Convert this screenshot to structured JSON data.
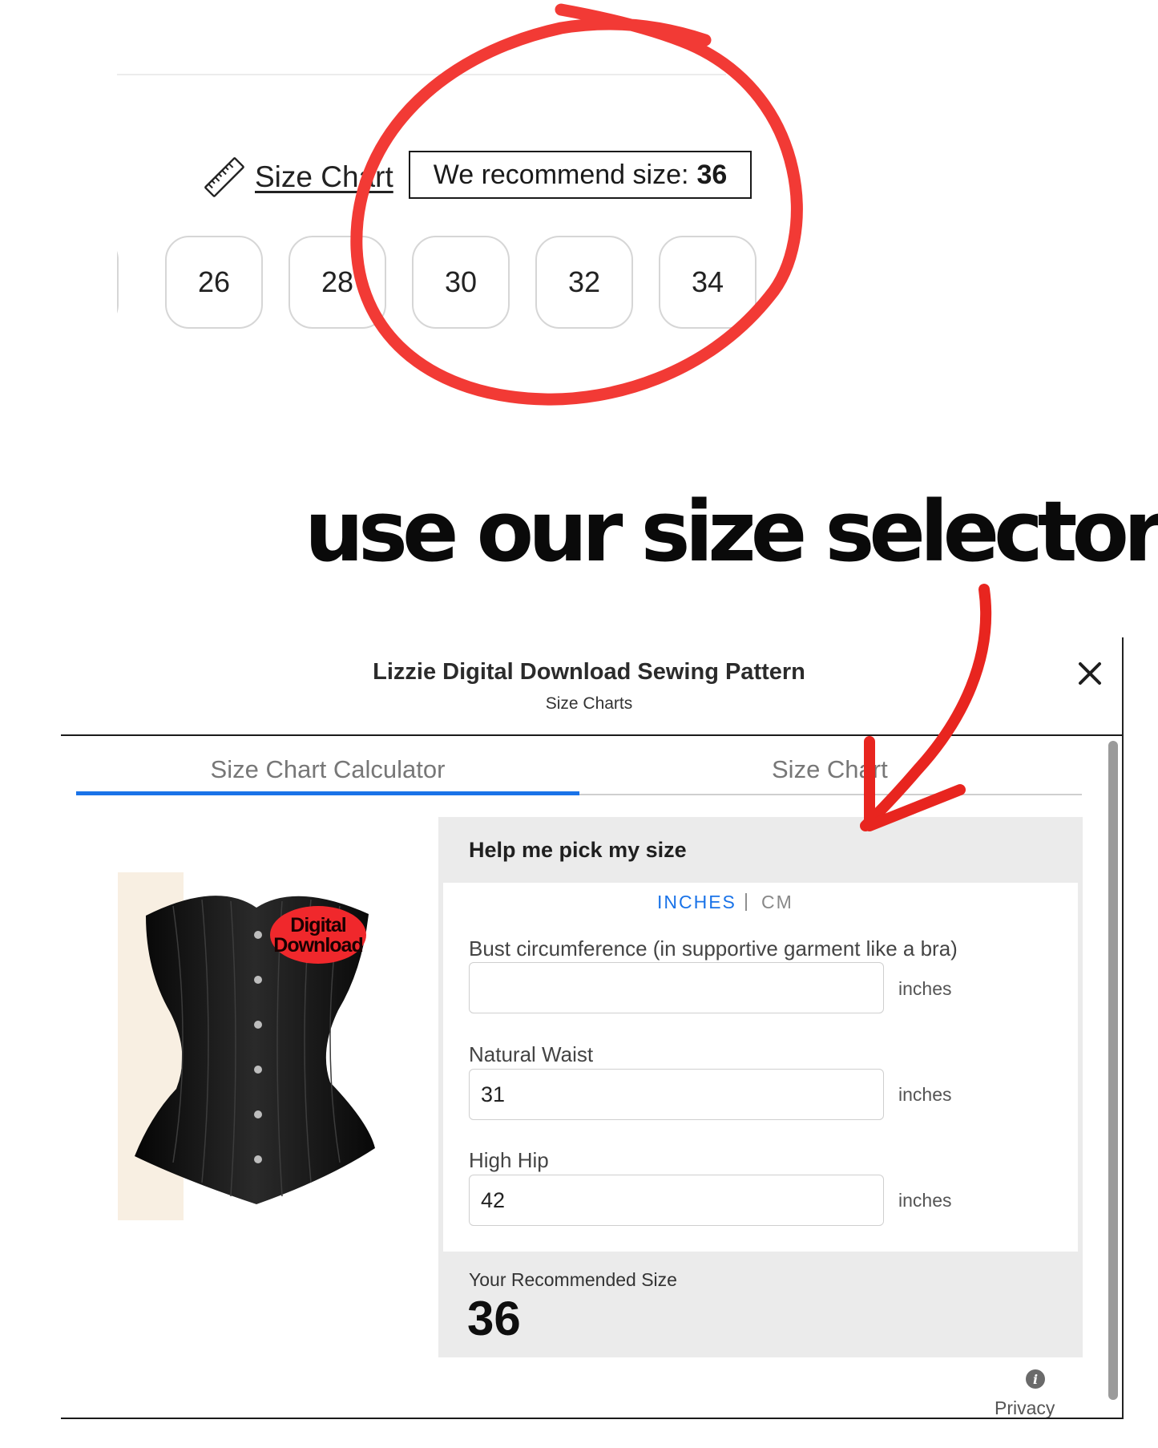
{
  "product_page": {
    "size_chart_label": "Size Chart",
    "recommend_prefix": "We recommend size:",
    "recommend_value": "36",
    "sizes": [
      "26",
      "28",
      "30",
      "32",
      "34"
    ]
  },
  "annotation": {
    "text": "use our size selector",
    "circle_color": "#f23a35",
    "arrow_color": "#e8251f"
  },
  "modal": {
    "title": "Lizzie Digital Download Sewing Pattern",
    "subtitle": "Size Charts",
    "close_icon": "close-icon",
    "tabs": [
      {
        "label": "Size Chart Calculator",
        "active": true
      },
      {
        "label": "Size Chart",
        "active": false
      }
    ],
    "product_badge": [
      "Digital",
      "Download"
    ],
    "calculator": {
      "heading": "Help me pick my size",
      "units": {
        "inches": "INCHES",
        "separator": "|",
        "cm": "CM",
        "selected": "inches"
      },
      "fields": [
        {
          "label": "Bust circumference (in supportive garment like a bra)",
          "value": "",
          "unit": "inches"
        },
        {
          "label": "Natural Waist",
          "value": "31",
          "unit": "inches"
        },
        {
          "label": "High Hip",
          "value": "42",
          "unit": "inches"
        }
      ],
      "result_label": "Your Recommended Size",
      "result_value": "36"
    },
    "privacy_label": "Privacy",
    "accent_color": "#1a73e8"
  }
}
